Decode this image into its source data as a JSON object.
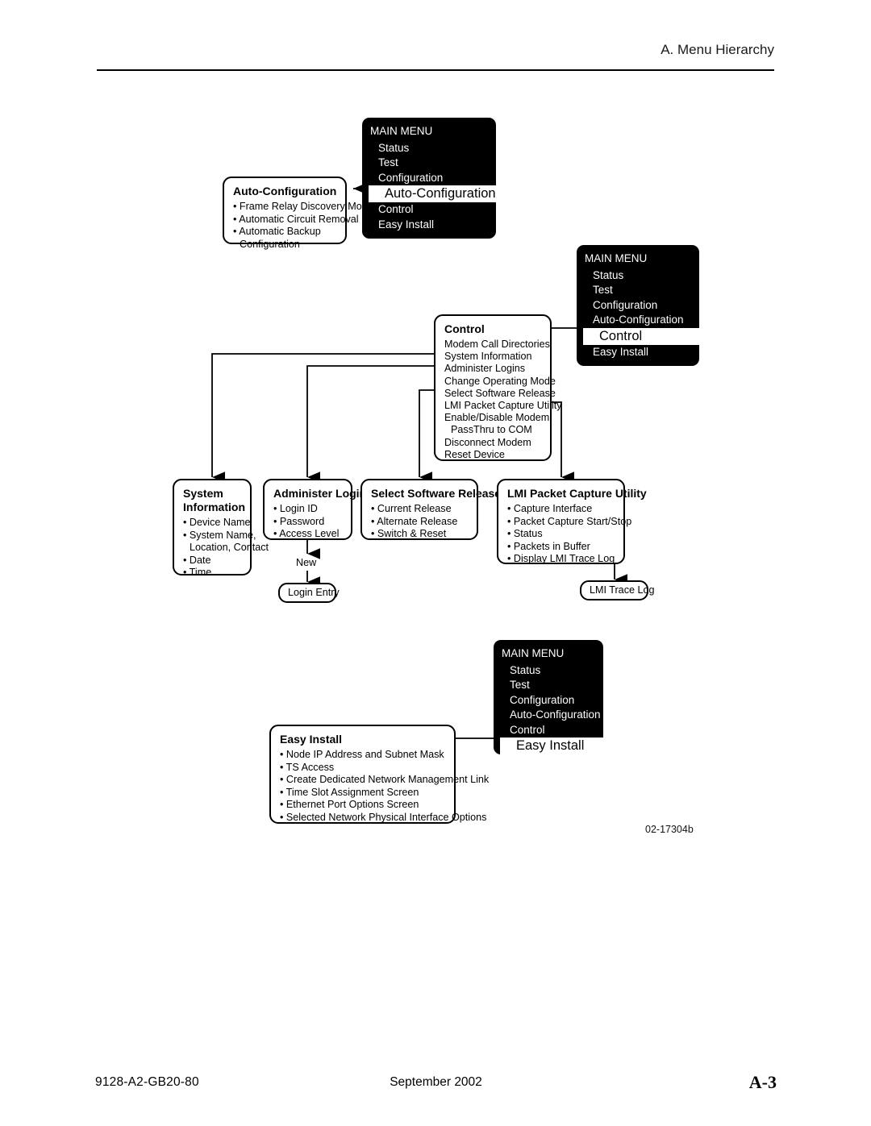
{
  "header": {
    "title": "A. Menu Hierarchy"
  },
  "footer": {
    "document_number": "9128-A2-GB20-80",
    "date": "September 2002",
    "page": "A-3"
  },
  "figure": {
    "id": "02-17304b"
  },
  "main_menu": {
    "title": "MAIN MENU",
    "items": [
      "Status",
      "Test",
      "Configuration",
      "Auto-Configuration",
      "Control",
      "Easy Install"
    ]
  },
  "panels": [
    {
      "name": "main-menu-auto-configuration",
      "title": "MAIN MENU",
      "rows": [
        "Status",
        "Test",
        "Configuration",
        "Auto-Configuration",
        "Control",
        "Easy Install"
      ],
      "selected": "Auto-Configuration"
    },
    {
      "name": "main-menu-control",
      "title": "MAIN MENU",
      "rows": [
        "Status",
        "Test",
        "Configuration",
        "Auto-Configuration",
        "Control",
        "Easy Install"
      ],
      "selected": "Control"
    },
    {
      "name": "main-menu-easy-install",
      "title": "MAIN MENU",
      "rows": [
        "Status",
        "Test",
        "Configuration",
        "Auto-Configuration",
        "Control",
        "Easy Install"
      ],
      "selected": "Easy Install"
    }
  ],
  "auto_configuration": {
    "title": "Auto-Configuration",
    "items": [
      "• Frame Relay Discovery Mode",
      "• Automatic Circuit Removal",
      "• Automatic Backup",
      "Configuration"
    ]
  },
  "control": {
    "title": "Control",
    "items": [
      "Modem Call Directories",
      "System Information",
      "Administer Logins",
      "Change Operating Mode",
      "Select Software Release",
      "LMI Packet Capture Utility",
      "Enable/Disable Modem",
      "PassThru to COM",
      "Disconnect Modem",
      "Reset Device"
    ]
  },
  "system_information": {
    "title_line1": "System",
    "title_line2": "Information",
    "items": [
      "• Device Name",
      "• System Name,",
      "Location, Contact",
      "• Date",
      "• Time"
    ]
  },
  "administer_logins": {
    "title": "Administer Logins",
    "items": [
      "• Login ID",
      "• Password",
      "• Access Level"
    ],
    "edge_label": "New",
    "terminal": "Login Entry"
  },
  "select_software_release": {
    "title": "Select Software Release",
    "items": [
      "• Current Release",
      "• Alternate Release",
      "• Switch & Reset"
    ]
  },
  "lmi_packet_capture_utility": {
    "title": "LMI Packet Capture Utility",
    "items": [
      "• Capture Interface",
      "• Packet Capture Start/Stop",
      "• Status",
      "• Packets in Buffer",
      "• Display LMI Trace Log"
    ],
    "terminal": "LMI Trace Log"
  },
  "easy_install": {
    "title": "Easy Install",
    "items": [
      "• Node IP Address and Subnet Mask",
      "• TS Access",
      "• Create Dedicated Network Management Link",
      "• Time Slot Assignment Screen",
      "• Ethernet Port Options Screen",
      "• Selected Network Physical Interface Options"
    ]
  },
  "colors": {
    "panel_bg": "#000000",
    "panel_text": "#ffffff",
    "selected_bg": "#ffffff",
    "selected_text": "#000000",
    "line": "#000000"
  }
}
